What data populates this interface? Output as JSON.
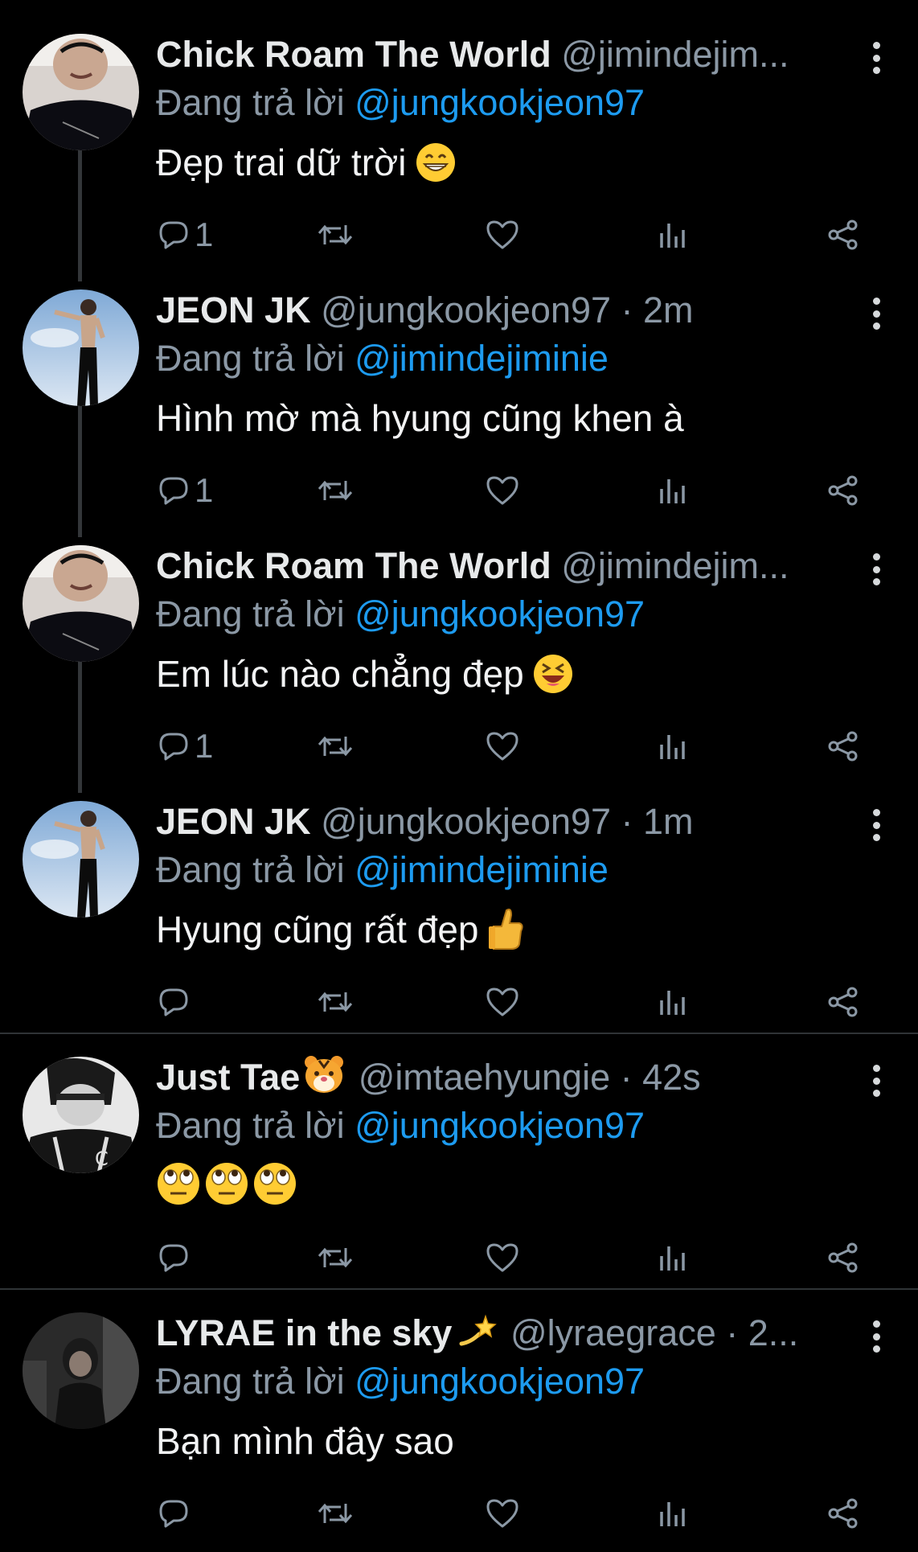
{
  "reply_prefix": "Đang trả lời",
  "tweets": [
    {
      "name": "Chick Roam The World",
      "handle": "@jimindejim...",
      "time": "",
      "replying_to": "@jungkookjeon97",
      "text": "Đẹp trai dữ trời",
      "text_emoji": "grin-emoji",
      "reply_count": "1",
      "avatar": "jimin-avatar"
    },
    {
      "name": "JEON JK",
      "handle": "@jungkookjeon97 · 2m",
      "time": "",
      "replying_to": "@jimindejiminie",
      "text": "Hình mờ mà hyung cũng khen à",
      "text_emoji": "",
      "reply_count": "1",
      "avatar": "jk-avatar"
    },
    {
      "name": "Chick Roam The World",
      "handle": "@jimindejim...",
      "time": "",
      "replying_to": "@jungkookjeon97",
      "text": "Em lúc nào chẳng đẹp",
      "text_emoji": "laughing-emoji",
      "reply_count": "1",
      "avatar": "jimin-avatar"
    },
    {
      "name": "JEON JK",
      "handle": "@jungkookjeon97 · 1m",
      "time": "",
      "replying_to": "@jimindejiminie",
      "text": "Hyung cũng rất đẹp",
      "text_emoji": "thumbs-up-emoji",
      "reply_count": "",
      "avatar": "jk-avatar"
    },
    {
      "name": "Just Tae",
      "name_emoji": "tiger-emoji",
      "handle": "@imtaehyungie · 42s",
      "time": "",
      "replying_to": "@jungkookjeon97",
      "text": "",
      "text_emoji": "eye-roll-emoji-x3",
      "reply_count": "",
      "avatar": "tae-avatar"
    },
    {
      "name": "LYRAE in the sky",
      "name_emoji": "dizzy-emoji",
      "handle": "@lyraegrace · 2...",
      "time": "",
      "replying_to": "@jungkookjeon97",
      "text": "Bạn mình đây sao",
      "text_emoji": "",
      "reply_count": "",
      "avatar": "lyrae-avatar"
    }
  ],
  "colors": {
    "background": "#000000",
    "text": "#e7e9ea",
    "secondary": "#8b98a5",
    "mention": "#1d9bf0",
    "thread_line": "#333639"
  }
}
